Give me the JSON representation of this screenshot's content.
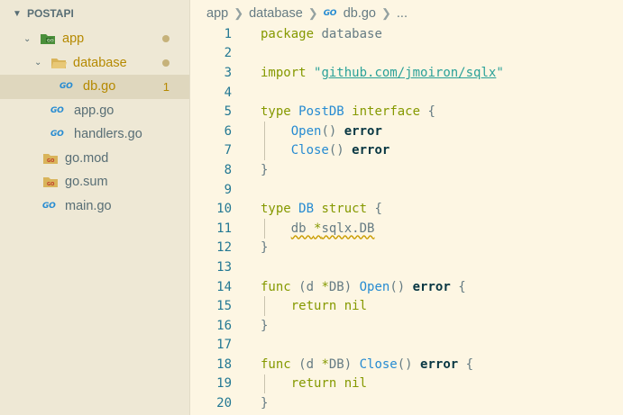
{
  "explorer": {
    "project_name": "POSTAPI",
    "items": [
      {
        "label": "app",
        "type": "folder-go",
        "badge": "dot",
        "modified": true
      },
      {
        "label": "database",
        "type": "folder",
        "badge": "dot",
        "modified": true
      },
      {
        "label": "db.go",
        "type": "go",
        "badge": "1",
        "modified": true,
        "selected": true
      },
      {
        "label": "app.go",
        "type": "go"
      },
      {
        "label": "handlers.go",
        "type": "go"
      },
      {
        "label": "go.mod",
        "type": "gomod"
      },
      {
        "label": "go.sum",
        "type": "gomod"
      },
      {
        "label": "main.go",
        "type": "go"
      }
    ]
  },
  "breadcrumb": {
    "seg1": "app",
    "seg2": "database",
    "file": "db.go",
    "more": "..."
  },
  "go_icon_text": "GO",
  "code": {
    "line_numbers": [
      "1",
      "2",
      "3",
      "4",
      "5",
      "6",
      "7",
      "8",
      "9",
      "10",
      "11",
      "12",
      "13",
      "14",
      "15",
      "16",
      "17",
      "18",
      "19",
      "20"
    ],
    "lines": [
      [
        {
          "t": "package",
          "c": "kw"
        },
        {
          "t": " database",
          "c": "id"
        }
      ],
      [],
      [
        {
          "t": "import",
          "c": "kw"
        },
        {
          "t": " ",
          "c": "id"
        },
        {
          "t": "\"",
          "c": "str"
        },
        {
          "t": "github.com/jmoiron/sqlx",
          "c": "strlink"
        },
        {
          "t": "\"",
          "c": "str"
        }
      ],
      [],
      [
        {
          "t": "type",
          "c": "kw"
        },
        {
          "t": " ",
          "c": "id"
        },
        {
          "t": "PostDB",
          "c": "tp"
        },
        {
          "t": " ",
          "c": "id"
        },
        {
          "t": "interface",
          "c": "kw"
        },
        {
          "t": " {",
          "c": "id"
        }
      ],
      [
        {
          "t": "    ",
          "c": "id"
        },
        {
          "t": "Open",
          "c": "tp"
        },
        {
          "t": "() ",
          "c": "id"
        },
        {
          "t": "error",
          "c": "bold"
        }
      ],
      [
        {
          "t": "    ",
          "c": "id"
        },
        {
          "t": "Close",
          "c": "tp"
        },
        {
          "t": "() ",
          "c": "id"
        },
        {
          "t": "error",
          "c": "bold"
        }
      ],
      [
        {
          "t": "}",
          "c": "id"
        }
      ],
      [],
      [
        {
          "t": "type",
          "c": "kw"
        },
        {
          "t": " ",
          "c": "id"
        },
        {
          "t": "DB",
          "c": "tp"
        },
        {
          "t": " ",
          "c": "id"
        },
        {
          "t": "struct",
          "c": "kw"
        },
        {
          "t": " {",
          "c": "id"
        }
      ],
      [
        {
          "t": "    ",
          "c": "id"
        },
        {
          "t": "db ",
          "c": "id squig"
        },
        {
          "t": "*",
          "c": "op squig"
        },
        {
          "t": "sqlx.DB",
          "c": "id squig"
        }
      ],
      [
        {
          "t": "}",
          "c": "id"
        }
      ],
      [],
      [
        {
          "t": "func",
          "c": "kw"
        },
        {
          "t": " (d ",
          "c": "id"
        },
        {
          "t": "*",
          "c": "op"
        },
        {
          "t": "DB) ",
          "c": "id"
        },
        {
          "t": "Open",
          "c": "tp"
        },
        {
          "t": "() ",
          "c": "id"
        },
        {
          "t": "error",
          "c": "bold"
        },
        {
          "t": " {",
          "c": "id"
        }
      ],
      [
        {
          "t": "    ",
          "c": "id"
        },
        {
          "t": "return",
          "c": "kw"
        },
        {
          "t": " ",
          "c": "id"
        },
        {
          "t": "nil",
          "c": "kw"
        }
      ],
      [
        {
          "t": "}",
          "c": "id"
        }
      ],
      [],
      [
        {
          "t": "func",
          "c": "kw"
        },
        {
          "t": " (d ",
          "c": "id"
        },
        {
          "t": "*",
          "c": "op"
        },
        {
          "t": "DB) ",
          "c": "id"
        },
        {
          "t": "Close",
          "c": "tp"
        },
        {
          "t": "() ",
          "c": "id"
        },
        {
          "t": "error",
          "c": "bold"
        },
        {
          "t": " {",
          "c": "id"
        }
      ],
      [
        {
          "t": "    ",
          "c": "id"
        },
        {
          "t": "return",
          "c": "kw"
        },
        {
          "t": " ",
          "c": "id"
        },
        {
          "t": "nil",
          "c": "kw"
        }
      ],
      [
        {
          "t": "}",
          "c": "id"
        }
      ]
    ]
  }
}
